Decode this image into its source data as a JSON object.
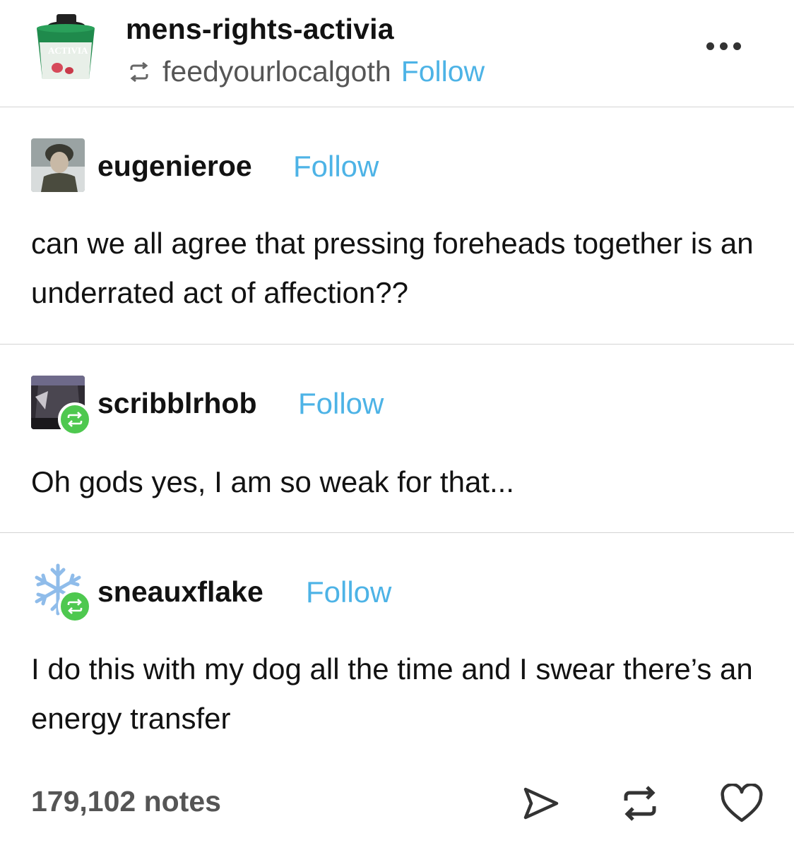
{
  "header": {
    "blog_name": "mens-rights-activia",
    "reblogged_from": "feedyourlocalgoth",
    "follow_label": "Follow",
    "avatar_label": "ACTIVIA",
    "avatar_icon": "yogurt-cup-avatar",
    "more_icon": "more-options-icon"
  },
  "posts": [
    {
      "username": "eugenieroe",
      "follow_label": "Follow",
      "text": "can we all agree that pressing foreheads together is an underrated act of affection??",
      "avatar_icon": "soldier-photo-avatar"
    },
    {
      "username": "scribblrhob",
      "follow_label": "Follow",
      "text": "Oh gods yes, I am so weak for that...",
      "avatar_icon": "anime-character-avatar",
      "badge_icon": "reblog-badge-icon"
    },
    {
      "username": "sneauxflake",
      "follow_label": "Follow",
      "text": "I do this with my dog all the time and I swear there’s an energy transfer",
      "avatar_icon": "snowflake-avatar",
      "badge_icon": "reblog-badge-icon"
    }
  ],
  "footer": {
    "notes": "179,102 notes",
    "actions": [
      "share-icon",
      "reblog-icon",
      "like-icon"
    ]
  },
  "colors": {
    "follow": "#4db3e6",
    "reblog_badge": "#4ec84f",
    "divider": "#d4d4d4"
  }
}
